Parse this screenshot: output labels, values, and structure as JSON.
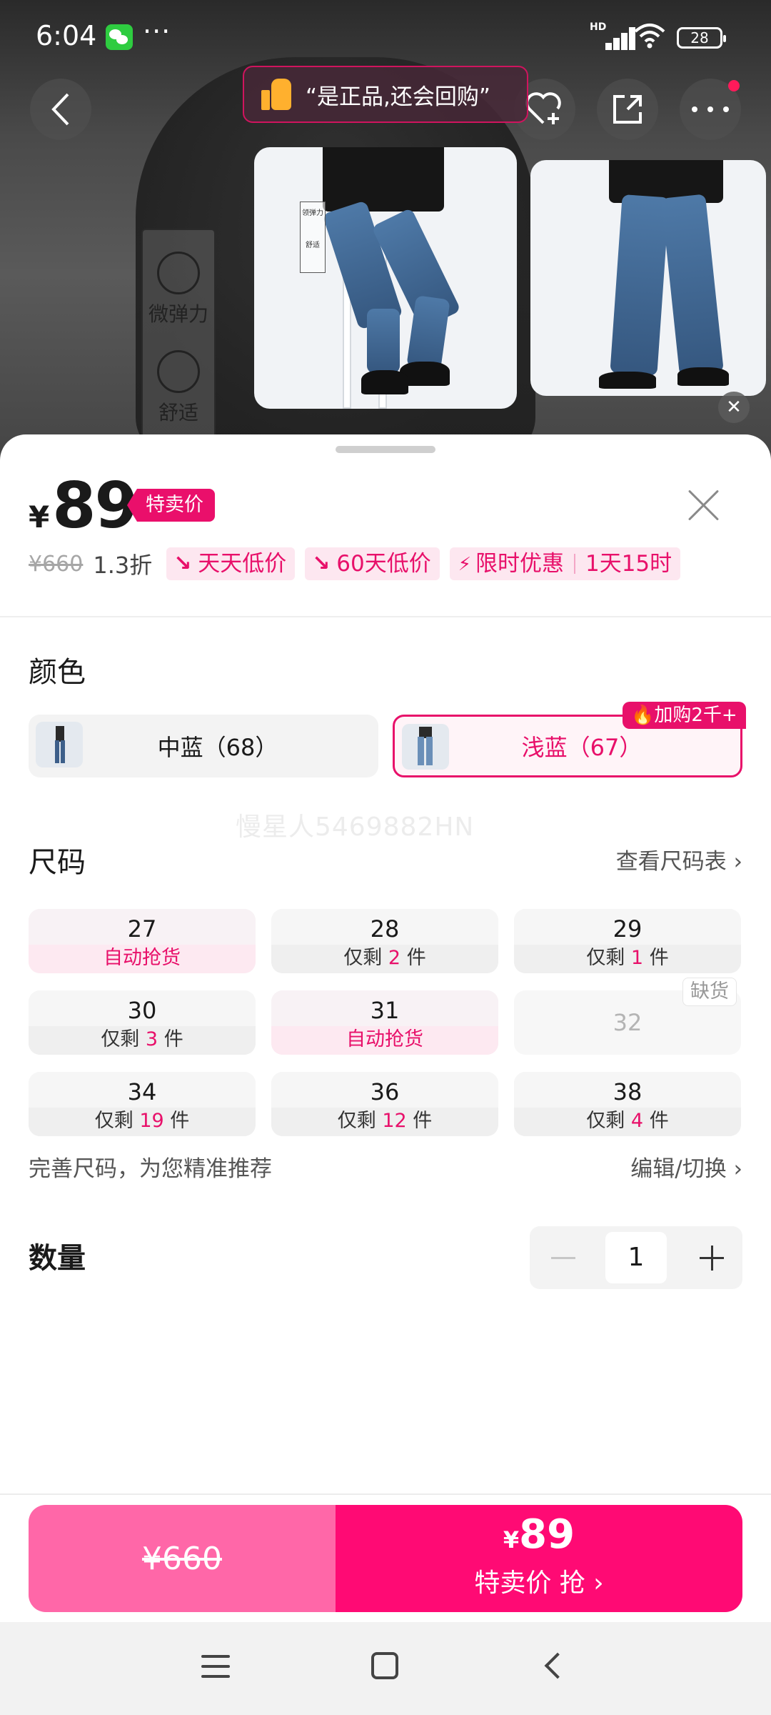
{
  "status_bar": {
    "time": "6:04",
    "more": "···",
    "network": "HD",
    "battery": "28"
  },
  "tip": {
    "text": "“是正品,还会回购”"
  },
  "background_tags": [
    "微弹力",
    "舒适"
  ],
  "preview_label": [
    "领弹力",
    "舒适"
  ],
  "product": {
    "currency": "¥",
    "price": "89",
    "price_badge": "特卖价",
    "original_price": "¥660",
    "discount": "1.3折",
    "chips": [
      {
        "icon": "trend-down-icon",
        "text": "天天低价"
      },
      {
        "icon": "trend-down-icon",
        "text": "60天低价"
      },
      {
        "icon": "lightning-icon",
        "text": "限时优惠",
        "extra": "1天15时"
      }
    ]
  },
  "color_section": {
    "title": "颜色",
    "options": [
      {
        "label": "中蓝（68）",
        "selected": false
      },
      {
        "label": "浅蓝（67）",
        "selected": true
      }
    ],
    "hot_tag": "加购2千+"
  },
  "watermark": "慢星人5469882HN",
  "size_section": {
    "title": "尺码",
    "chart_link": "查看尺码表",
    "oos_tag": "缺货",
    "sizes": [
      {
        "size": "27",
        "stock_text": "自动抢货",
        "type": "auto"
      },
      {
        "size": "28",
        "prefix": "仅剩",
        "count": "2",
        "suffix": "件",
        "type": "left"
      },
      {
        "size": "29",
        "prefix": "仅剩",
        "count": "1",
        "suffix": "件",
        "type": "left"
      },
      {
        "size": "30",
        "prefix": "仅剩",
        "count": "3",
        "suffix": "件",
        "type": "left"
      },
      {
        "size": "31",
        "stock_text": "自动抢货",
        "type": "auto"
      },
      {
        "size": "32",
        "type": "oos"
      },
      {
        "size": "34",
        "prefix": "仅剩",
        "count": "19",
        "suffix": "件",
        "type": "left"
      },
      {
        "size": "36",
        "prefix": "仅剩",
        "count": "12",
        "suffix": "件",
        "type": "left"
      },
      {
        "size": "38",
        "prefix": "仅剩",
        "count": "4",
        "suffix": "件",
        "type": "left"
      }
    ],
    "hint": "完善尺码，为您精准推荐",
    "edit_link": "编辑/切换"
  },
  "quantity": {
    "title": "数量",
    "value": "1"
  },
  "buy_bar": {
    "left_price": "¥660",
    "right_currency": "¥",
    "right_price": "89",
    "right_label": "特卖价 抢"
  },
  "colors": {
    "accent": "#e8106a",
    "buy_left": "#ff67a8",
    "buy_right": "#ff0a74"
  }
}
